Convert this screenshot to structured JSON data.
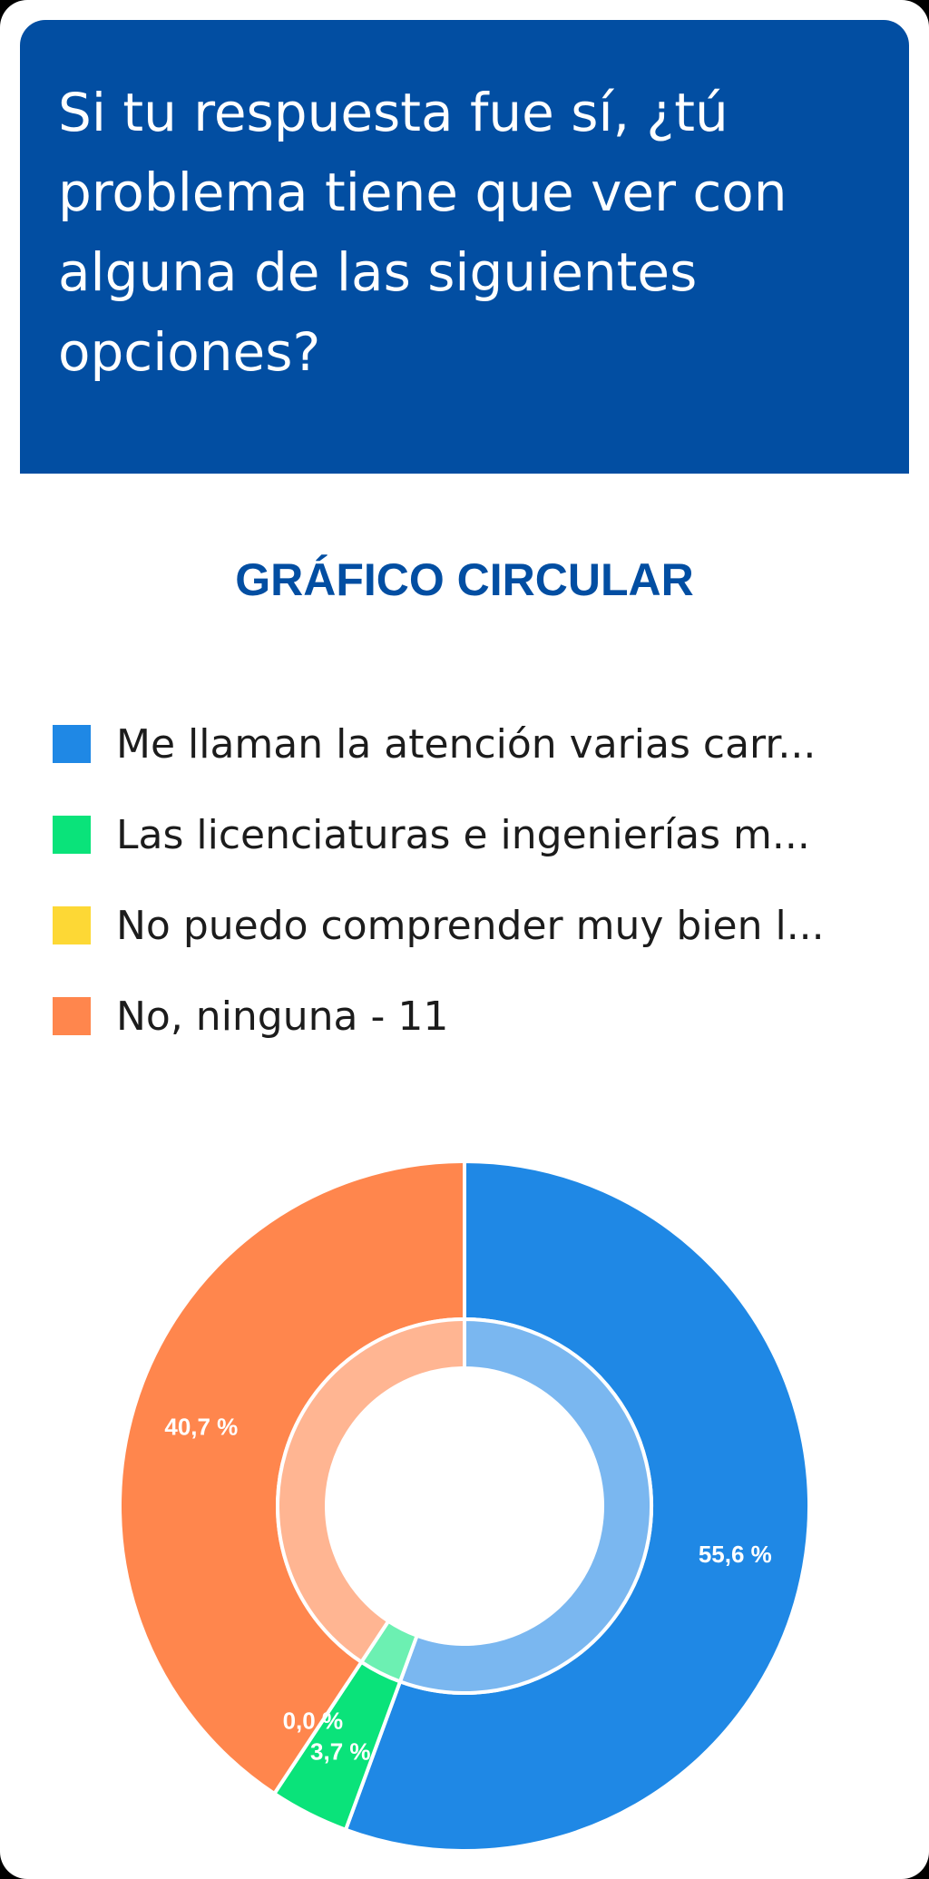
{
  "question": "Si tu respuesta fue sí, ¿tú problema tiene que ver con alguna de las siguientes opciones?",
  "chart_title": "GRÁFICO CIRCULAR",
  "legend": [
    {
      "label": "Me llaman la atención varias carr...",
      "color": "#1f88e5"
    },
    {
      "label": "Las licenciaturas e ingenierías m...",
      "color": "#0ae37a"
    },
    {
      "label": "No puedo comprender muy bien l...",
      "color": "#fdd835"
    },
    {
      "label": "No, ninguna - 11",
      "color": "#ff864d"
    }
  ],
  "chart_data": {
    "type": "pie",
    "style": "donut",
    "title": "GRÁFICO CIRCULAR",
    "legend_position": "top",
    "slices": [
      {
        "name": "Me llaman la atención varias carr...",
        "value": 55.6,
        "label": "55,6 %",
        "color": "#1f88e5",
        "inner_color": "#7ab7f0"
      },
      {
        "name": "Las licenciaturas e ingenierías m...",
        "value": 3.7,
        "label": "3,7 %",
        "color": "#0ae37a",
        "inner_color": "#6cf0b2"
      },
      {
        "name": "No puedo comprender muy bien l...",
        "value": 0.0,
        "label": "0,0 %",
        "color": "#fdd835",
        "inner_color": "#fde98a"
      },
      {
        "name": "No, ninguna - 11",
        "value": 40.7,
        "label": "40,7 %",
        "color": "#ff864d",
        "inner_color": "#ffb592"
      }
    ]
  }
}
